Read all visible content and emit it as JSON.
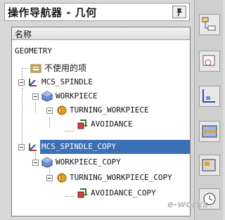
{
  "navigator": {
    "title": "操作导航器 - 几何",
    "pin_icon": "pin-icon",
    "column_header": "名称",
    "rows": [
      {
        "label": "GEOMETRY",
        "icon": "none"
      },
      {
        "label": "不使用的项",
        "icon": "unused-items-icon"
      },
      {
        "label": "MCS_SPINDLE",
        "icon": "mcs-spindle-icon"
      },
      {
        "label": "WORKPIECE",
        "icon": "workpiece-icon"
      },
      {
        "label": "TURNING_WORKPIECE",
        "icon": "turning-workpiece-icon"
      },
      {
        "label": "AVOIDANCE",
        "icon": "avoidance-icon"
      },
      {
        "label": "MCS_SPINDLE_COPY",
        "icon": "mcs-spindle-icon",
        "selected": true
      },
      {
        "label": "WORKPIECE_COPY",
        "icon": "workpiece-icon"
      },
      {
        "label": "TURNING_WORKPIECE_COPY",
        "icon": "turning-workpiece-icon"
      },
      {
        "label": "AVOIDANCE_COPY",
        "icon": "avoidance-icon"
      }
    ]
  },
  "watermark": "e-works",
  "colors": {
    "selection": "#3b6fb6",
    "panel": "#d8d8d8"
  }
}
